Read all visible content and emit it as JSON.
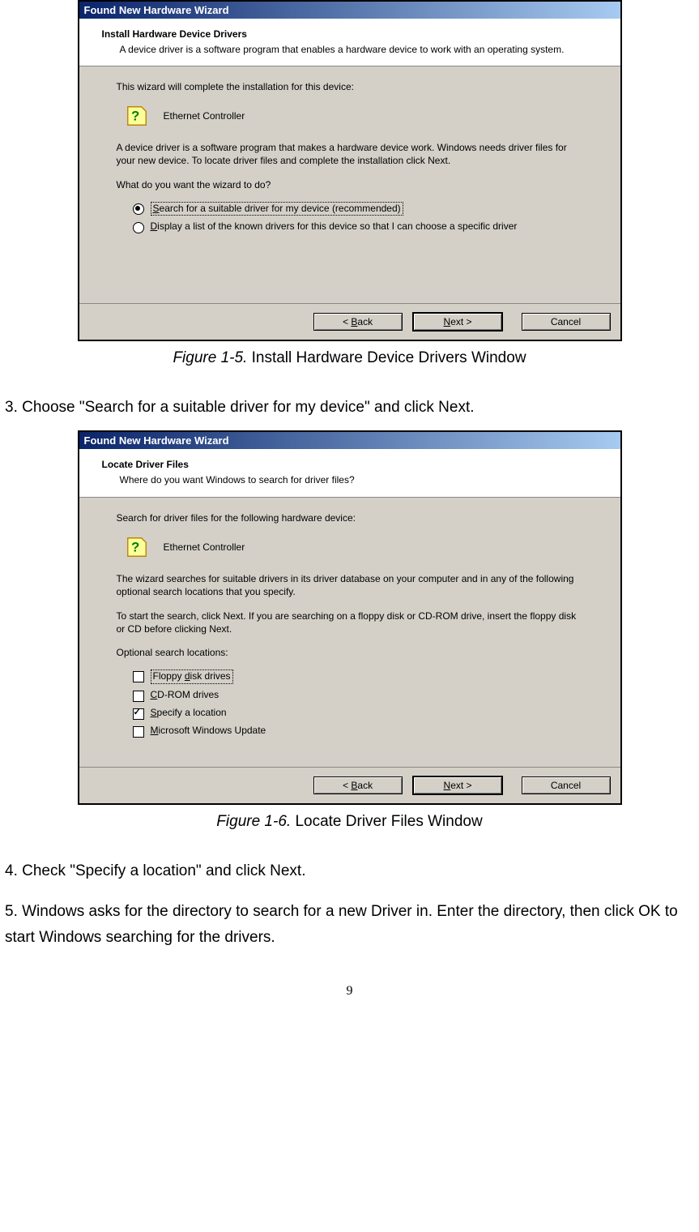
{
  "dialog1": {
    "title": "Found New Hardware Wizard",
    "header_title": "Install Hardware Device Drivers",
    "header_sub": "A device driver is a software program that enables a hardware device to work with an operating system.",
    "prompt1": "This wizard will complete the installation for this device:",
    "device_name": "Ethernet Controller",
    "para2": "A device driver is a software program that makes a hardware device work. Windows needs driver files for your new device. To locate driver files and complete the installation click Next.",
    "prompt2": "What do you want the wizard to do?",
    "radio1_pre": "S",
    "radio1_rest": "earch for a suitable driver for my device (recommended)",
    "radio2_pre": "D",
    "radio2_rest": "isplay a list of the known drivers for this device so that I can choose a specific driver",
    "btn_back_pre": "< ",
    "btn_back_u": "B",
    "btn_back_rest": "ack",
    "btn_next_pre": "",
    "btn_next_u": "N",
    "btn_next_rest": "ext >",
    "btn_cancel": "Cancel"
  },
  "caption1_label": "Figure 1-5.",
  "caption1_text": " Install Hardware Device Drivers Window",
  "instruction3": "3. Choose \"Search for a suitable driver for my device\" and click Next.",
  "dialog2": {
    "title": "Found New Hardware Wizard",
    "header_title": "Locate Driver Files",
    "header_sub": "Where do you want Windows to search for driver files?",
    "prompt1": "Search for driver files for the following hardware device:",
    "device_name": "Ethernet Controller",
    "para2": "The wizard searches for suitable drivers in its driver database on your computer and in any of the following optional search locations that you specify.",
    "para3": "To start the search, click Next. If you are searching on a floppy disk or CD-ROM drive, insert the floppy disk or CD before clicking Next.",
    "prompt2": "Optional search locations:",
    "chk1_u": "d",
    "chk1_pre": "Floppy ",
    "chk1_rest": "isk drives",
    "chk2_u": "C",
    "chk2_rest": "D-ROM drives",
    "chk3_u": "S",
    "chk3_rest": "pecify a location",
    "chk4_u": "M",
    "chk4_rest": "icrosoft Windows Update",
    "btn_back_pre": "< ",
    "btn_back_u": "B",
    "btn_back_rest": "ack",
    "btn_next_u": "N",
    "btn_next_rest": "ext >",
    "btn_cancel": "Cancel"
  },
  "caption2_label": "Figure 1-6.",
  "caption2_text": " Locate Driver Files Window",
  "instruction4": "4. Check \"Specify a location\" and click Next.",
  "instruction5": "5. Windows asks for the directory to search for a new Driver in. Enter the directory, then click OK to start Windows searching for the drivers.",
  "page_number": "9"
}
